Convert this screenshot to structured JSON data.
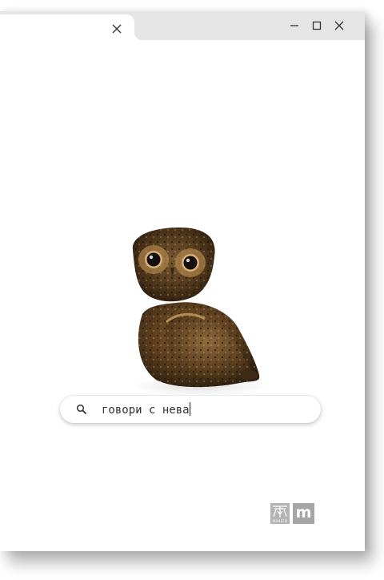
{
  "window": {
    "tab_close_icon": "close-icon",
    "controls": [
      "minimize-icon",
      "maximize-icon",
      "close-icon"
    ]
  },
  "search": {
    "value": "говори с нева",
    "icon": "search-icon"
  },
  "logos": {
    "left": {
      "icon": "pavilion-logo",
      "lettering": "МАНЕГИ"
    },
    "right": {
      "letter": "m"
    }
  },
  "colors": {
    "titlebar": "#e6e6e6",
    "background": "#ffffff",
    "logo_gray": "#a6a6a6"
  }
}
